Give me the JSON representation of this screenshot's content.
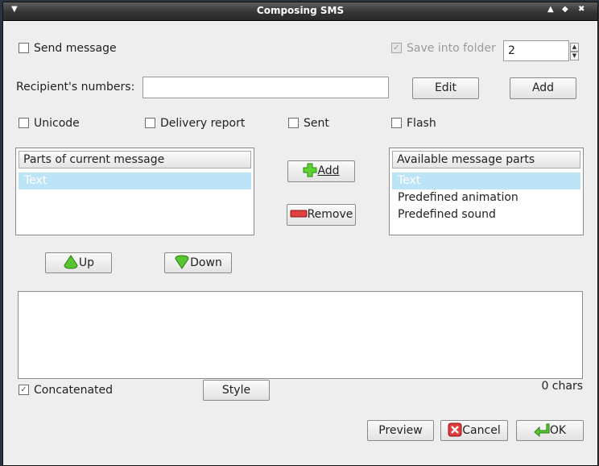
{
  "window": {
    "title": "Composing SMS"
  },
  "options": {
    "send_message": "Send message",
    "save_into_folder": "Save into folder",
    "folder_value": "2",
    "recipients_label": "Recipient's numbers:",
    "recipients_value": "",
    "edit": "Edit",
    "add": "Add",
    "unicode": "Unicode",
    "delivery_report": "Delivery report",
    "sent": "Sent",
    "flash": "Flash"
  },
  "parts": {
    "current_header": "Parts of current message",
    "current_items": [
      "Text"
    ],
    "available_header": "Available message parts",
    "available_items": [
      "Text",
      "Predefined animation",
      "Predefined sound"
    ],
    "add": "Add",
    "remove": "Remove",
    "up": "Up",
    "down": "Down"
  },
  "editor": {
    "text": "",
    "concatenated": "Concatenated",
    "style": "Style",
    "char_count": "0 chars"
  },
  "footer": {
    "preview": "Preview",
    "cancel": "Cancel",
    "ok": "OK"
  }
}
